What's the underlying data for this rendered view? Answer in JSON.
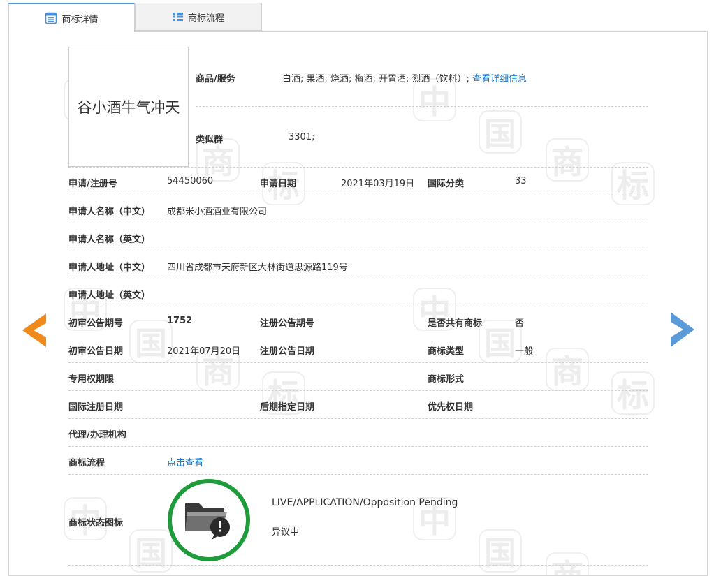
{
  "tabs": [
    {
      "label": "商标详情",
      "active": true,
      "icon": "list-doc-icon"
    },
    {
      "label": "商标流程",
      "active": false,
      "icon": "list-bullets-icon"
    }
  ],
  "trademark": {
    "image_text": "谷小酒牛气冲天",
    "goods_label": "商品/服务",
    "goods_value": "白酒; 果酒; 烧酒; 梅酒; 开胃酒; 烈酒（饮料）;",
    "goods_link": "查看详细信息",
    "similar_label": "类似群",
    "similar_value": "3301;"
  },
  "fields": {
    "reg_no_label": "申请/注册号",
    "reg_no_value": "54450060",
    "apply_date_label": "申请日期",
    "apply_date_value": "2021年03月19日",
    "intl_class_label": "国际分类",
    "intl_class_value": "33",
    "applicant_cn_label": "申请人名称（中文）",
    "applicant_cn_value": "成都米小酒酒业有限公司",
    "applicant_en_label": "申请人名称（英文）",
    "address_cn_label": "申请人地址（中文）",
    "address_cn_value": "四川省成都市天府新区大林街道思源路119号",
    "address_en_label": "申请人地址（英文）",
    "prelim_no_label": "初审公告期号",
    "prelim_no_value": "1752",
    "reg_pub_no_label": "注册公告期号",
    "shared_label": "是否共有商标",
    "shared_value": "否",
    "prelim_date_label": "初审公告日期",
    "prelim_date_value": "2021年07月20日",
    "reg_pub_date_label": "注册公告日期",
    "tm_type_label": "商标类型",
    "tm_type_value": "一般",
    "exclusive_label": "专用权期限",
    "tm_form_label": "商标形式",
    "intl_reg_date_label": "国际注册日期",
    "later_designation_label": "后期指定日期",
    "priority_date_label": "优先权日期",
    "agent_label": "代理/办理机构",
    "process_label": "商标流程",
    "process_link": "点击查看",
    "status_label": "商标状态图标",
    "status_en": "LIVE/APPLICATION/Opposition Pending",
    "status_cn": "异议中"
  },
  "colors": {
    "accent": "#4a90d9",
    "link": "#1a77c9",
    "prev_arrow": "#f08a1c",
    "next_arrow": "#5b9bd8",
    "status_ring": "#1e9c3c"
  },
  "watermark": {
    "chars": [
      "中",
      "国",
      "商",
      "标"
    ]
  }
}
